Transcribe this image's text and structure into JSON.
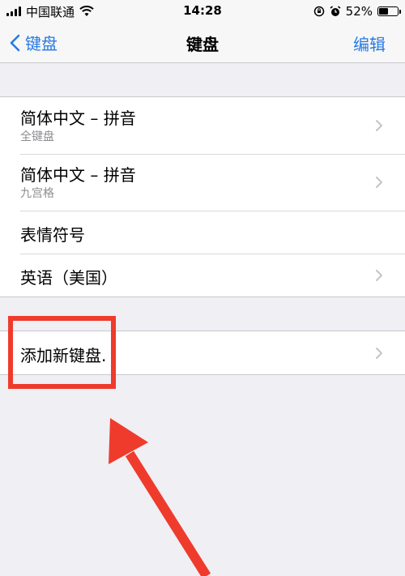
{
  "status_bar": {
    "carrier": "中国联通",
    "time": "14:28",
    "battery_percent": "52%",
    "battery_level": 0.52
  },
  "nav": {
    "back_label": "键盘",
    "title": "键盘",
    "edit_label": "编辑"
  },
  "keyboards": [
    {
      "title": "简体中文 – 拼音",
      "subtitle": "全键盘",
      "has_chevron": true
    },
    {
      "title": "简体中文 – 拼音",
      "subtitle": "九宫格",
      "has_chevron": true
    },
    {
      "title": "表情符号",
      "subtitle": "",
      "has_chevron": false
    },
    {
      "title": "英语（美国）",
      "subtitle": "",
      "has_chevron": true
    }
  ],
  "add_keyboard": {
    "label": "添加新键盘."
  },
  "colors": {
    "accent": "#2a7ae2",
    "annotation": "#ef3b2c",
    "background": "#efeff4"
  },
  "icons": [
    "signal-icon",
    "wifi-icon",
    "alarm-icon",
    "lock-rotation-icon",
    "battery-icon",
    "back-chevron-icon",
    "chevron-right-icon",
    "arrow-annotation"
  ]
}
